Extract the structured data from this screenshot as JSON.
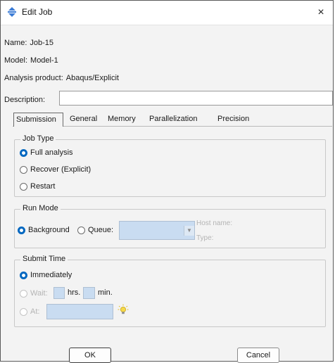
{
  "window": {
    "title": "Edit Job",
    "close_glyph": "×"
  },
  "info": {
    "name_label": "Name:",
    "name_value": "Job-15",
    "model_label": "Model:",
    "model_value": "Model-1",
    "product_label": "Analysis product:",
    "product_value": "Abaqus/Explicit",
    "description_label": "Description:",
    "description_value": ""
  },
  "tabs": [
    {
      "label": "Submission",
      "active": true
    },
    {
      "label": "General",
      "active": false
    },
    {
      "label": "Memory",
      "active": false
    },
    {
      "label": "Parallelization",
      "active": false
    },
    {
      "label": "Precision",
      "active": false
    }
  ],
  "job_type": {
    "title": "Job Type",
    "options": [
      {
        "label": "Full analysis",
        "checked": true
      },
      {
        "label": "Recover (Explicit)",
        "checked": false
      },
      {
        "label": "Restart",
        "checked": false
      }
    ]
  },
  "run_mode": {
    "title": "Run Mode",
    "background_label": "Background",
    "background_checked": true,
    "queue_label": "Queue:",
    "queue_checked": false,
    "queue_value": "",
    "host_name_label": "Host name:",
    "type_label": "Type:"
  },
  "submit_time": {
    "title": "Submit Time",
    "immediately_label": "Immediately",
    "immediately_checked": true,
    "wait_label": "Wait:",
    "hrs_label": "hrs.",
    "min_label": "min.",
    "at_label": "At:"
  },
  "buttons": {
    "ok_label": "OK",
    "cancel_label": "Cancel"
  },
  "colors": {
    "accent": "#0067c0",
    "field_fill": "#c9dcf1",
    "dialog_bg": "#f3f3f3",
    "icon_blue": "#3a7bd5",
    "bulb_yellow": "#e6c229"
  },
  "icons": {
    "title_icon": "abaqus-job-icon",
    "bulb_icon": "lightbulb-icon"
  }
}
